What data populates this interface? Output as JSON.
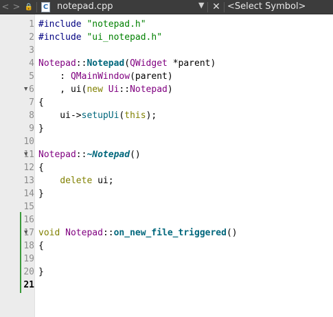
{
  "toolbar": {
    "back_glyph": "<",
    "forward_glyph": ">",
    "lock_glyph": "🔒",
    "file_icon_glyph": "C",
    "file_name": "notepad.cpp",
    "dropdown_glyph": "▼",
    "close_glyph": "✕",
    "symbol_select": "<Select Symbol>"
  },
  "editor": {
    "current_line": 21,
    "change_bar_color": "#3a9a3a",
    "lines": [
      {
        "num": "1"
      },
      {
        "num": "2"
      },
      {
        "num": "3"
      },
      {
        "num": "4"
      },
      {
        "num": "5"
      },
      {
        "num": "6"
      },
      {
        "num": "7"
      },
      {
        "num": "8"
      },
      {
        "num": "9"
      },
      {
        "num": "10"
      },
      {
        "num": "11"
      },
      {
        "num": "12"
      },
      {
        "num": "13"
      },
      {
        "num": "14"
      },
      {
        "num": "15"
      },
      {
        "num": "16"
      },
      {
        "num": "17"
      },
      {
        "num": "18"
      },
      {
        "num": "19"
      },
      {
        "num": "20"
      },
      {
        "num": "21"
      }
    ],
    "fold_markers": [
      6,
      11,
      17
    ],
    "code": {
      "l1_a": "#include ",
      "l1_b": "\"notepad.h\"",
      "l2_a": "#include ",
      "l2_b": "\"ui_notepad.h\"",
      "l4_a": "Notepad",
      "l4_b": "::",
      "l4_c": "Notepad",
      "l4_d": "(",
      "l4_e": "QWidget",
      "l4_f": " *parent)",
      "l5_a": "    : ",
      "l5_b": "QMainWindow",
      "l5_c": "(parent)",
      "l6_a": "    , ui(",
      "l6_b": "new",
      "l6_c": " ",
      "l6_d": "Ui",
      "l6_e": "::",
      "l6_f": "Notepad",
      "l6_g": ")",
      "l7": "{",
      "l8_a": "    ui->",
      "l8_b": "setupUi",
      "l8_c": "(",
      "l8_d": "this",
      "l8_e": ");",
      "l9": "}",
      "l11_a": "Notepad",
      "l11_b": "::",
      "l11_c": "~Notepad",
      "l11_d": "()",
      "l12": "{",
      "l13_a": "    ",
      "l13_b": "delete",
      "l13_c": " ui;",
      "l14": "}",
      "l17_a": "void",
      "l17_b": " ",
      "l17_c": "Notepad",
      "l17_d": "::",
      "l17_e": "on_new_file_triggered",
      "l17_f": "()",
      "l18": "{",
      "l20": "}"
    }
  }
}
